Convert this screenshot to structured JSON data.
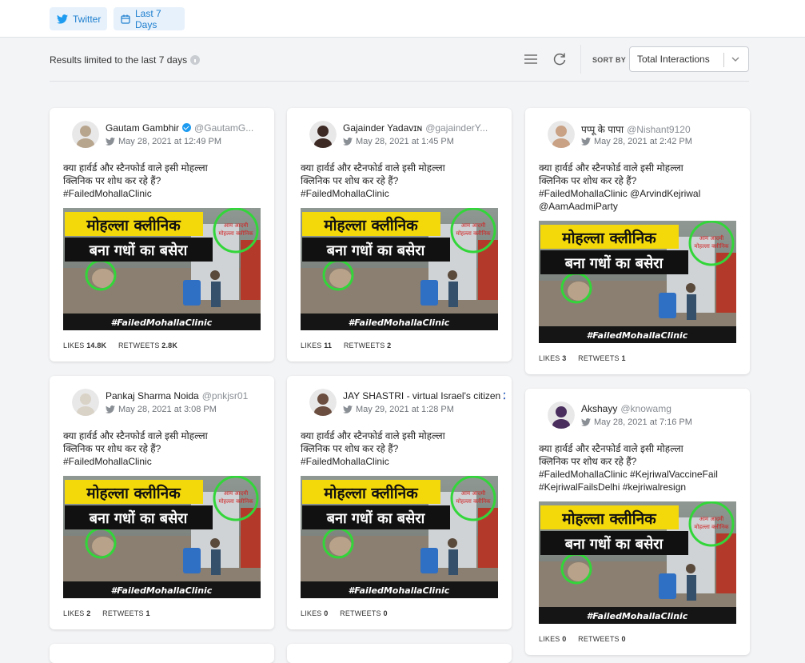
{
  "filters": {
    "network_label": "Twitter",
    "range_label": "Last 7 Days"
  },
  "toolbar": {
    "limit_text": "Results limited to the last 7 days",
    "sort_label": "SORT BY",
    "sort_value": "Total Interactions"
  },
  "colors": {
    "accent": "#1d7fcf",
    "chip_bg": "#e7f1fb",
    "page_bg": "#f3f4f6",
    "verified": "#1d9bf0"
  },
  "icons": [
    "twitter-icon",
    "calendar-icon",
    "info-icon",
    "list-view-icon",
    "refresh-icon",
    "chevron-down-icon",
    "verified-badge-icon"
  ],
  "media": {
    "headline_line1": "मोहल्ला क्लीनिक",
    "headline_line2": "बना गधों का बसेरा",
    "hashtag_banner": "#FailedMohallaClinic",
    "sign_text": "आम आदमी मोहल्ला क्लीनिक"
  },
  "stats_labels": {
    "likes": "LIKES",
    "retweets": "RETWEETS"
  },
  "tweets": [
    {
      "name": "Gautam Gambhir",
      "verified": true,
      "handle": "@GautamG...",
      "date": "May 28, 2021 at 12:49 PM",
      "lines": [
        "क्या हार्वर्ड और स्टैनफोर्ड वाले इसी मोहल्ला",
        "क्लिनिक पर शोध कर रहे हैं?",
        "#FailedMohallaClinic"
      ],
      "likes": "14.8K",
      "retweets": "2.8K"
    },
    {
      "name": "Gajainder Yadavɪɴ",
      "handle": "@gajainderY...",
      "date": "May 28, 2021 at 1:45 PM",
      "lines": [
        "क्या हार्वर्ड और स्टैनफोर्ड वाले इसी मोहल्ला",
        "क्लिनिक पर शोध कर रहे हैं?",
        "#FailedMohallaClinic"
      ],
      "likes": "11",
      "retweets": "2"
    },
    {
      "name": "पप्पू के पापा",
      "handle": "@Nishant9120",
      "date": "May 28, 2021 at 2:42 PM",
      "lines": [
        "क्या हार्वर्ड और स्टैनफोर्ड वाले इसी मोहल्ला",
        "क्लिनिक पर शोध कर रहे हैं?",
        "#FailedMohallaClinic @ArvindKejriwal",
        "@AamAadmiParty"
      ],
      "likes": "3",
      "retweets": "1"
    },
    {
      "name": "Pankaj Sharma Noida",
      "handle": "@pnkjsr01",
      "date": "May 28, 2021 at 3:08 PM",
      "lines": [
        "क्या हार्वर्ड और स्टैनफोर्ड वाले इसी मोहल्ला",
        "क्लिनिक पर शोध कर रहे हैं?",
        "#FailedMohallaClinic"
      ],
      "likes": "2",
      "retweets": "1"
    },
    {
      "name": "JAY SHASTRI - virtual Israel's citizen 🇮🇱",
      "handle": "",
      "date": "May 29, 2021 at 1:28 PM",
      "lines": [
        "क्या हार्वर्ड और स्टैनफोर्ड वाले इसी मोहल्ला",
        "क्लिनिक पर शोध कर रहे हैं?",
        "#FailedMohallaClinic"
      ],
      "likes": "0",
      "retweets": "0"
    },
    {
      "name": "Akshayy",
      "handle": "@knowamg",
      "date": "May 28, 2021 at 7:16 PM",
      "lines": [
        "क्या हार्वर्ड और स्टैनफोर्ड वाले इसी मोहल्ला",
        "क्लिनिक पर शोध कर रहे हैं?",
        "#FailedMohallaClinic #KejriwalVaccineFail",
        "#KejriwalFailsDelhi #kejriwalresign"
      ],
      "likes": "0",
      "retweets": "0"
    }
  ]
}
